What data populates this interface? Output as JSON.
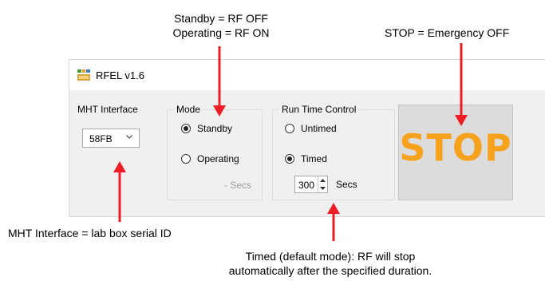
{
  "annotations": {
    "standby_line1": "Standby = RF OFF",
    "standby_line2": "Operating = RF ON",
    "stop": "STOP = Emergency OFF",
    "mht": "MHT Interface = lab box serial ID",
    "timed_line1": "Timed (default mode): RF will stop",
    "timed_line2": "automatically after the specified duration."
  },
  "window": {
    "title": "RFEL v1.6"
  },
  "mht_interface": {
    "label": "MHT Interface",
    "selected": "58FB"
  },
  "mode": {
    "label": "Mode",
    "options": [
      {
        "label": "Standby",
        "checked": true
      },
      {
        "label": "Operating",
        "checked": false
      }
    ],
    "secs_label": "- Secs"
  },
  "run_time_control": {
    "label": "Run Time Control",
    "options": [
      {
        "label": "Untimed",
        "checked": false
      },
      {
        "label": "Timed",
        "checked": true
      }
    ],
    "duration_value": "300",
    "duration_unit": "Secs"
  },
  "stop_button": {
    "label": "STOP"
  },
  "colors": {
    "arrow": "#ee1c25",
    "stop_text": "#f7a21d"
  }
}
